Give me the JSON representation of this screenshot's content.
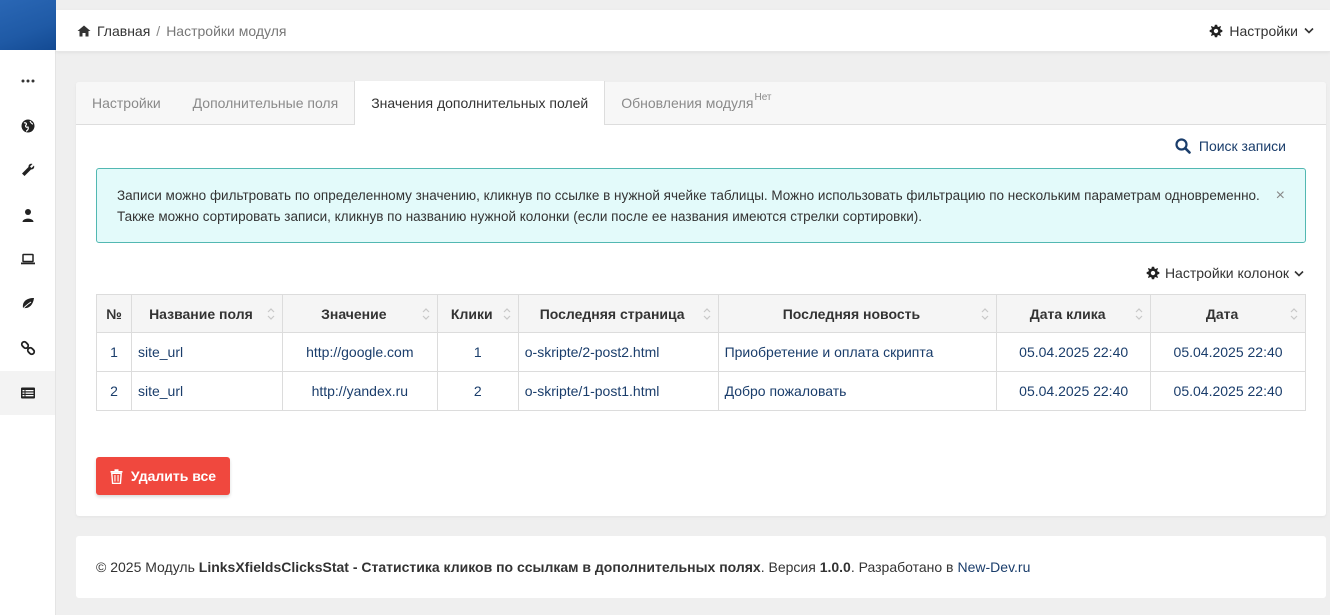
{
  "sidebar": {
    "items": [
      {
        "name": "more-icon"
      },
      {
        "name": "globe-icon"
      },
      {
        "name": "wrench-icon"
      },
      {
        "name": "user-icon"
      },
      {
        "name": "laptop-icon"
      },
      {
        "name": "leaf-icon"
      },
      {
        "name": "link-icon"
      },
      {
        "name": "list-icon"
      }
    ]
  },
  "breadcrumb": {
    "home": "Главная",
    "separator": "/",
    "current": "Настройки модуля"
  },
  "header": {
    "settings_label": "Настройки"
  },
  "tabs": [
    {
      "label": "Настройки",
      "active": false
    },
    {
      "label": "Дополнительные поля",
      "active": false
    },
    {
      "label": "Значения дополнительных полей",
      "active": true
    },
    {
      "label": "Обновления модуля",
      "badge": "Нет",
      "active": false
    }
  ],
  "search": {
    "label": "Поиск записи"
  },
  "alert": {
    "text": "Записи можно фильтровать по определенному значению, кликнув по ссылке в нужной ячейке таблицы. Можно использовать фильтрацию по нескольким параметрам одновременно. Также можно сортировать записи, кликнув по названию нужной колонки (если после ее названия имеются стрелки сортировки).",
    "close": "×"
  },
  "column_settings": {
    "label": "Настройки колонок"
  },
  "table": {
    "headers": [
      "№",
      "Название поля",
      "Значение",
      "Клики",
      "Последняя страница",
      "Последняя новость",
      "Дата клика",
      "Дата"
    ],
    "rows": [
      [
        "1",
        "site_url",
        "http://google.com",
        "1",
        "o-skripte/2-post2.html",
        "Приобретение и оплата скрипта",
        "05.04.2025 22:40",
        "05.04.2025 22:40"
      ],
      [
        "2",
        "site_url",
        "http://yandex.ru",
        "2",
        "o-skripte/1-post1.html",
        "Добро пожаловать",
        "05.04.2025 22:40",
        "05.04.2025 22:40"
      ]
    ]
  },
  "actions": {
    "delete_all": "Удалить все"
  },
  "footer": {
    "prefix": "© 2025 Модуль",
    "module_name": "LinksXfieldsClicksStat - Статистика кликов по ссылкам в дополнительных полях",
    "version_label": ". Версия",
    "version": "1.0.0",
    "developed_label": ". Разработано в",
    "developer": "New-Dev.ru"
  },
  "colors": {
    "accent_blue": "#1f5aa6",
    "link": "#1a3d6b",
    "alert_bg": "#e3fafa",
    "alert_border": "#52b8b2",
    "danger": "#f0483e"
  }
}
